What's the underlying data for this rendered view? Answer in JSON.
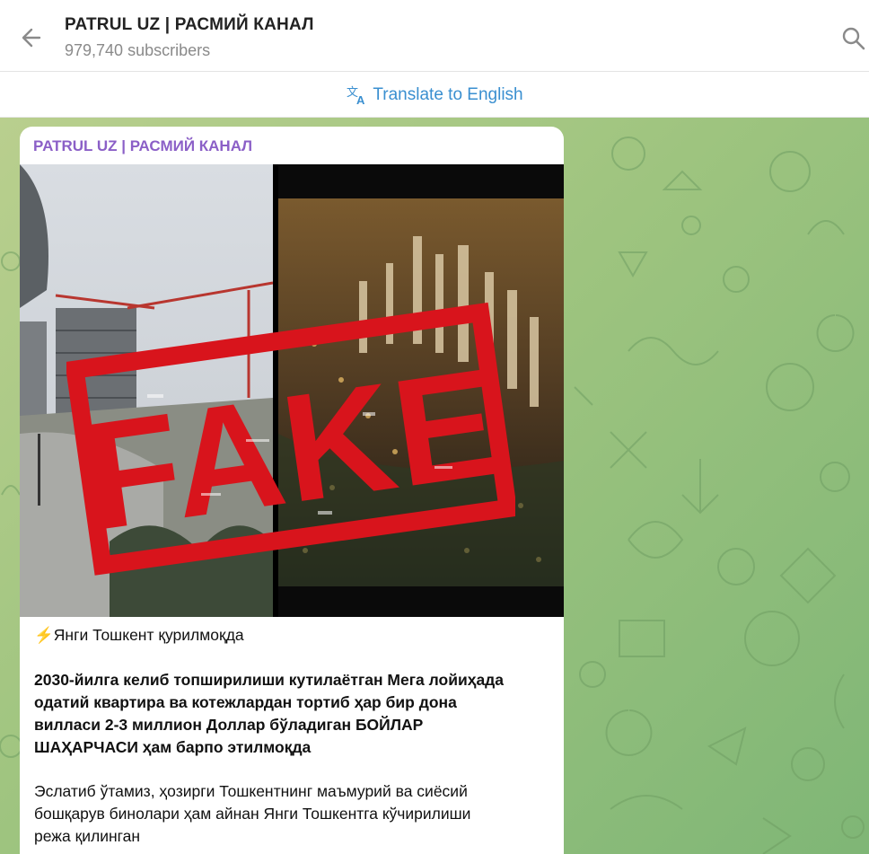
{
  "header": {
    "title": "PATRUL UZ | РАСМИЙ КАНАЛ",
    "subscribers": "979,740 subscribers",
    "back_icon": "arrow-left-icon",
    "search_icon": "search-icon"
  },
  "translate": {
    "label": "Translate to English",
    "icon": "translate-icon",
    "color": "#3a8fd0"
  },
  "message": {
    "author": "PATRUL UZ | РАСМИЙ КАНАЛ",
    "author_color": "#8b5fc7",
    "stamp_text": "FAKE",
    "stamp_color": "#d8141c",
    "headline_icon": "⚡",
    "headline": "Янги Тошкент қурилмоқда",
    "paragraph1_lines": [
      "2030-йилга келиб топширилиши кутилаётган Мега лойиҳада",
      "одатий квартира ва котежлардан тортиб ҳар бир дона",
      "вилласи 2-3 миллион Доллар бўладиган  БОЙЛАР",
      "ШАҲАРЧАСИ ҳам барпо этилмоқда"
    ],
    "paragraph2_lines": [
      "Эслатиб ўтамиз, ҳозирги Тошкентнинг маъмурий ва сиёсий",
      "бошқарув бинолари ҳам айнан Янги Тошкентга кўчирилиши",
      "режа қилинган"
    ]
  },
  "colors": {
    "chat_bg_start": "#b9cf8e",
    "chat_bg_end": "#7fb676"
  }
}
